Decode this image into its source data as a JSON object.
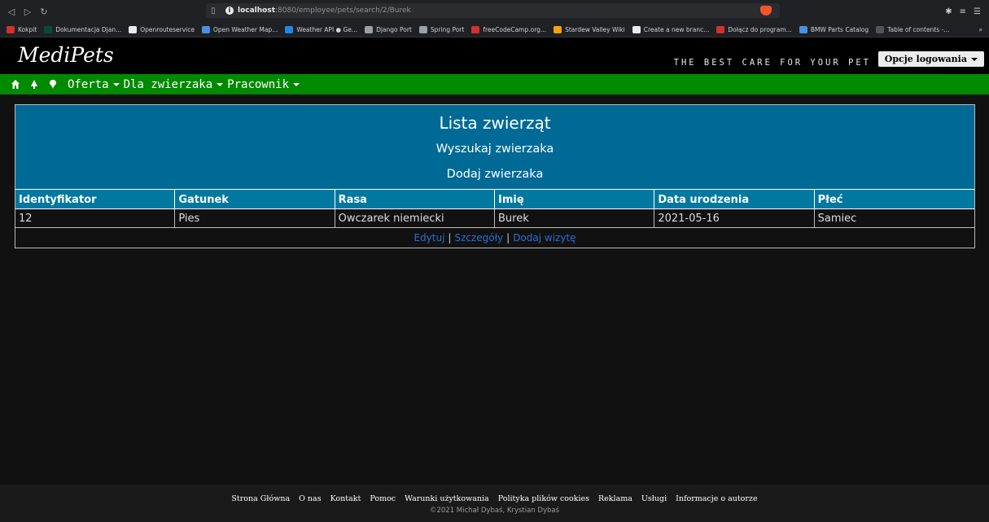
{
  "browser": {
    "url_host": "localhost",
    "url_path": ":8080/employee/pets/search/2/Burek",
    "bookmarks": [
      {
        "label": "Kokpit",
        "color": "#d32f2f"
      },
      {
        "label": "Dokumentacja Djan...",
        "color": "#0c4b33"
      },
      {
        "label": "Openrouteservice",
        "color": "#e8eaed"
      },
      {
        "label": "Open Weather Map...",
        "color": "#4a90e2"
      },
      {
        "label": "Weather API ● Ge...",
        "color": "#1e88e5"
      },
      {
        "label": "Django Port",
        "color": "#9aa0a6"
      },
      {
        "label": "Spring Port",
        "color": "#9aa0a6"
      },
      {
        "label": "freeCodeCamp.org...",
        "color": "#d32f2f"
      },
      {
        "label": "Stardew Valley Wiki",
        "color": "#f4a300"
      },
      {
        "label": "Create a new branc...",
        "color": "#e8eaed"
      },
      {
        "label": "Dołącz do program...",
        "color": "#d32f2f"
      },
      {
        "label": "BMW Parts Catalog",
        "color": "#4a90e2"
      },
      {
        "label": "Table of contents -...",
        "color": "#555"
      }
    ]
  },
  "site": {
    "logo": "MediPets",
    "tagline": "THE BEST CARE FOR YOUR PET",
    "login_label": "Opcje logowania",
    "nav": [
      "Oferta",
      "Dla zwierzaka",
      "Pracownik"
    ]
  },
  "panel": {
    "title": "Lista zwierząt",
    "search_link": "Wyszukaj zwierzaka",
    "add_link": "Dodaj zwierzaka",
    "columns": [
      "Identyfikator",
      "Gatunek",
      "Rasa",
      "Imię",
      "Data urodzenia",
      "Płeć"
    ],
    "rows": [
      [
        "12",
        "Pies",
        "Owczarek niemiecki",
        "Burek",
        "2021-05-16",
        "Samiec"
      ]
    ],
    "actions": [
      "Edytuj",
      "Szczegóły",
      "Dodaj wizytę"
    ]
  },
  "footer": {
    "links": [
      "Strona Główna",
      "O nas",
      "Kontakt",
      "Pomoc",
      "Warunki użytkowania",
      "Polityka plików cookies",
      "Reklama",
      "Usługi",
      "Informacje o autorze"
    ],
    "copyright": "©2021 Michał Dybaś, Krystian Dybaś"
  }
}
